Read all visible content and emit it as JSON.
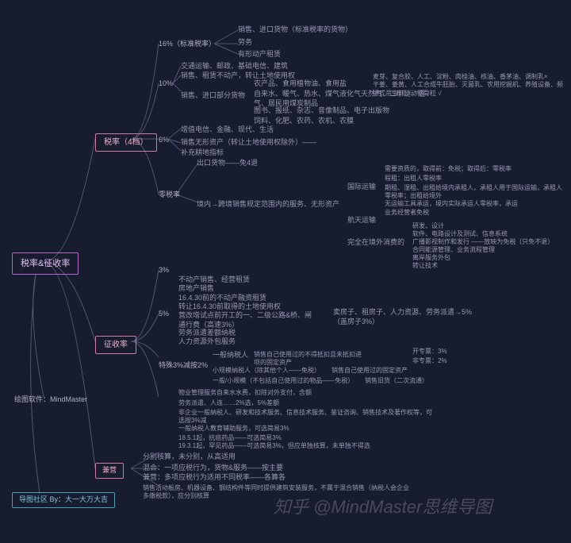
{
  "root": "税率&征收率",
  "footer": {
    "software": "绘图软件：MindMaster",
    "community": "导图社区 By：大一大万大吉"
  },
  "watermark": "知乎 @MindMaster思维导图",
  "ratesLabel": "税率（4档）",
  "r16": {
    "label": "16%（标准税率）",
    "items": [
      "销售、进口货物（标准税率的货物）",
      "劳务",
      "有形动产租赁"
    ]
  },
  "r10": {
    "label": "10%",
    "a": "交通运输、邮政、基础电信、建筑",
    "b": "销售、租赁不动产，转让土地使用权",
    "c": "销售、进口部分货物",
    "c_items": [
      "农产品、食用植物油、食用盐",
      "自来水、暖气、热水、煤气液化气天然气、二甲醚、沼气、居民用煤炭制品",
      "图书、报纸、杂志、音像制品、电子出版物",
      "饲料、化肥、农药、农机、农膜"
    ],
    "side1": "麦芽、复合胶、人工、淀粉、肉桂油、核油、香茅油、调制乳×\n干姜、姜黄、人工合成牛胚胎、灭菌乳、农用挖掘机、养殖设备、频振式杀虫灯、动物骨粒 √"
  },
  "r6": {
    "label": "6%",
    "a": "增值电信、金融、现代、生活",
    "b": "销售无形资产（转让土地使用权除外）——",
    "c": "补充耕地指标"
  },
  "r0": {
    "label": "零税率",
    "export": "出口货物——免4退",
    "in": "境内→跨境销售规定范围内的服务、无形资产",
    "guoji": {
      "label": "国际运输",
      "items": [
        "需要资质的，取得前：免税；取得后：零税率",
        "程租：出租人零税率",
        "期租、湿租、出租给境内承租人，承租人用于国际运输，承租人零税率；出租给境外",
        "无运输工具承运，境内实际承运人零税率，承运",
        "业务经营者免税"
      ]
    },
    "hangtian": "航天运输",
    "full": {
      "label": "完全在境外消费的",
      "items": [
        "研发、设计",
        "软件、电路设计及测试、信息系统",
        "广播影视制作和发行 ——放映为免税（只免不退）",
        "合同能源管理、业务流程管理",
        "离岸服务外包",
        "转让技术"
      ]
    }
  },
  "levyLabel": "征收率",
  "l3": {
    "label": "3%",
    "a": "不动产销售、经营租赁",
    "b": "房地产销售"
  },
  "l5": {
    "label": "5%",
    "items": [
      "16.4.30前的不动产融资租赁",
      "转让16.4.30前取得的土地使用权",
      "营改增试点前开工的一、二级公路&桥、闸通行费（高速3%）",
      "劳务派遣差额纳税",
      "人力资源外包服务"
    ],
    "side": "卖房子、租房子、人力资源、劳务派遣→5%\n（盖房子3%）"
  },
  "spec": {
    "label": "特殊3%减按2%",
    "a": "一般纳税人",
    "a1": "销售自己使用过的不得抵扣且未抵扣进项的固定资产",
    "a2": "开专票：3%",
    "a3": "非专票：2%",
    "b": "小规模纳税人（除其他个人——免税）",
    "b1": "销售自己使用过的固定资产",
    "c": "一般/小规模（不包括自己使用过的物品——免税）",
    "c1": "销售旧货（二次流通）"
  },
  "others": [
    "物业管理服务自来水水费，扣除对外支付，含额",
    "劳务派遣、人连……2%选，5%差额",
    "非企业一般纳税人、研发和技术服务、信息技术服务、鉴证咨询、销售技术及著作权等，可选按3%减",
    "一般纳税人教育辅助服务，可选简易3%",
    "18.5.1起，抗癌药品——可选简易3%\n19.3.1起，罕见药品——可选简易3%，但应单独核算，未单独不得选"
  ],
  "jianying": {
    "label": "兼营",
    "a": "分别核算，未分别，从高适用",
    "b": "混合：一项应税行为，货物&服务——按主要\n兼营：多项应税行为适用不同税率——各算各",
    "c": "销售活动板房、机器设备、钢结构件等同时提供建筑安装服务，不属于混合销售（纳税人会企业多缴税款），应分别核算"
  }
}
